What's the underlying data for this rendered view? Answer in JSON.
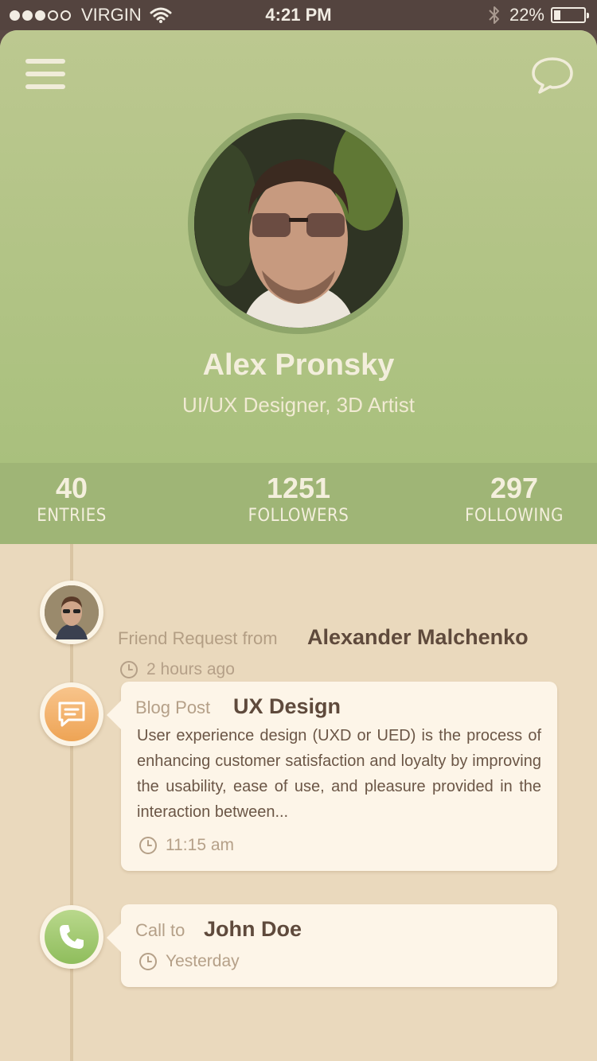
{
  "status_bar": {
    "carrier": "VIRGIN",
    "time": "4:21 PM",
    "battery_percent": "22%",
    "battery_level": 0.22,
    "signal_bars_filled": 3,
    "signal_bars_total": 5
  },
  "header": {
    "menu_icon": "hamburger-menu-icon",
    "chat_icon": "speech-bubble-icon",
    "colors": {
      "header_top": "#bcc890",
      "header_bottom": "#a9c07d",
      "stats_bar": "#9fb576"
    }
  },
  "profile": {
    "name": "Alex Pronsky",
    "role": "UI/UX Designer, 3D Artist"
  },
  "stats": [
    {
      "value": "40",
      "label": "ENTRIES"
    },
    {
      "value": "1251",
      "label": "FOLLOWERS"
    },
    {
      "value": "297",
      "label": "FOLLOWING"
    }
  ],
  "timeline": {
    "friend_request": {
      "label": "Friend Request from",
      "name": "Alexander Malchenko",
      "time": "2 hours ago"
    },
    "blog_post": {
      "label": "Blog Post",
      "title": "UX Design",
      "text": "User experience design (UXD or UED) is the process of enhancing customer satisfaction and loyalty by improving the usability, ease of use, and pleasure provided in the interaction between...",
      "time": "11:15 am",
      "icon": "comment-icon",
      "color": "#eea455"
    },
    "call": {
      "label": "Call to",
      "name": "John Doe",
      "time": "Yesterday",
      "icon": "phone-icon",
      "color": "#8fbd5c"
    }
  }
}
